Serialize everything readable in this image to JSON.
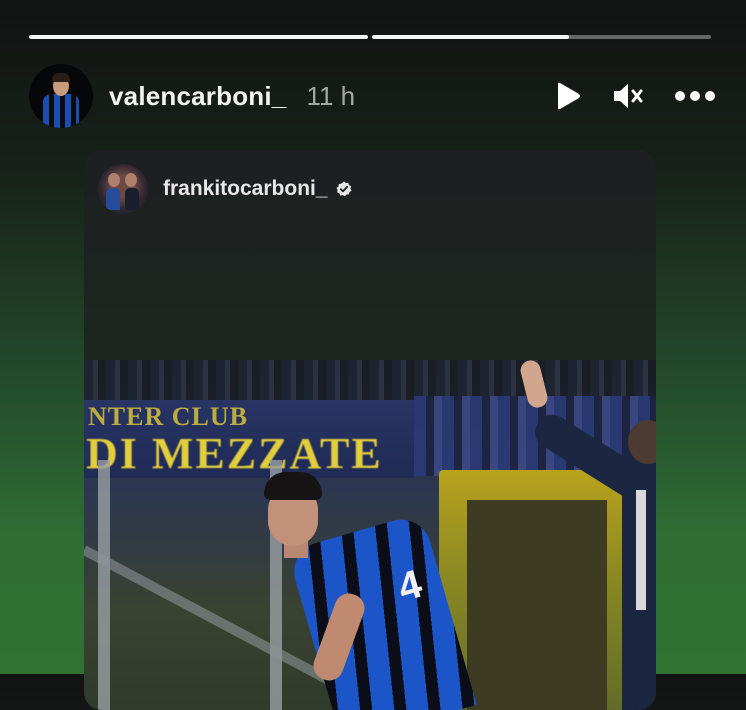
{
  "story": {
    "progress": [
      {
        "fill_pct": 100
      },
      {
        "fill_pct": 58
      }
    ],
    "header": {
      "username": "valencarboni_",
      "time": "11 h",
      "controls": {
        "play_icon": "play-icon",
        "mute_icon": "muted-speaker-icon",
        "more_icon": "more-horizontal-icon"
      }
    },
    "shared_post": {
      "username": "frankitocarboni_",
      "verified_icon": "verified-badge-icon",
      "photo": {
        "banner_line1": "NTER CLUB",
        "banner_line2": "DI MEZZATE",
        "jersey_number": "4"
      }
    }
  }
}
